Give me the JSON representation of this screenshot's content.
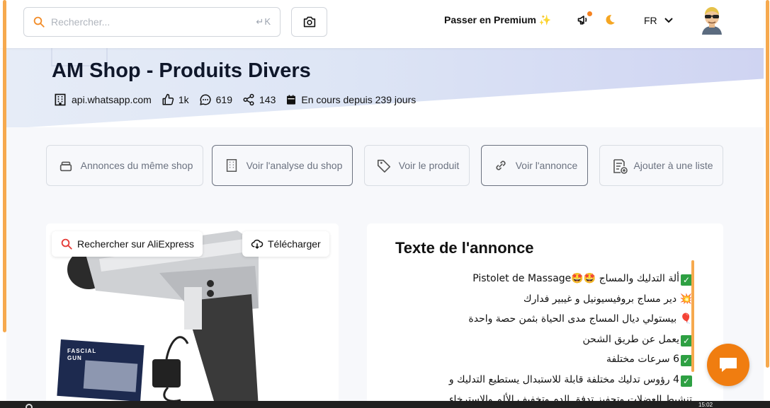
{
  "header": {
    "search": {
      "placeholder": "Rechercher...",
      "shortcut": "↵K"
    },
    "premium_label": "Passer en Premium",
    "language": "FR"
  },
  "shop": {
    "title": "AM Shop - Produits Divers",
    "domain": "api.whatsapp.com",
    "likes": "1k",
    "comments": "619",
    "shares": "143",
    "running": "En cours depuis 239 jours"
  },
  "actions": [
    {
      "label": "Annonces du même shop"
    },
    {
      "label": "Voir l'analyse du shop"
    },
    {
      "label": "Voir le produit"
    },
    {
      "label": "Voir l'annonce"
    },
    {
      "label": "Ajouter à une liste"
    }
  ],
  "media": {
    "search_aliexpress": "Rechercher sur AliExpress",
    "download": "Télécharger",
    "box_text": "FASCIAL GUN"
  },
  "ad_text": {
    "title": "Texte de l'annonce",
    "lines": [
      {
        "icon": "check",
        "text": "ألة التدليك والمساج 🤩🤩Pistolet de Massage"
      },
      {
        "icon": "boom",
        "text": "دير مساج بروفيسيونيل و غيبير فدارك"
      },
      {
        "icon": "balloon",
        "text": "بيستولي ديال المساج مدى الحياة بثمن حصة واحدة"
      },
      {
        "icon": "check",
        "text": "يعمل عن طريق الشحن"
      },
      {
        "icon": "check",
        "text": "6 سرعات مختلفة"
      },
      {
        "icon": "check",
        "text": "4 رؤوس تدليك مختلفة قابلة للاستبدال يستطيع التدليك و"
      },
      {
        "icon": "",
        "text": "تنشيط العضلات وتحفيز تدفق الدم وتخفيف الألم والاسترخاء"
      }
    ]
  },
  "taskbar": {
    "time": "15:02"
  },
  "colors": {
    "accent": "#f6a94e",
    "chat": "#f07d10",
    "check": "#2ea043"
  }
}
